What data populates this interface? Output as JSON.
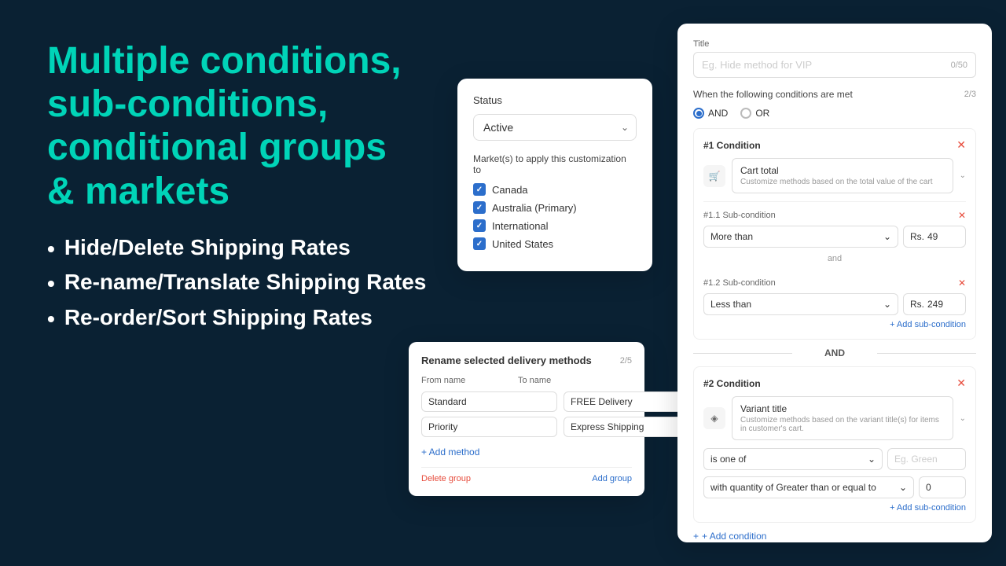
{
  "background": "#0a2133",
  "heading": {
    "line1": "Multiple conditions,",
    "line2": "sub-conditions,",
    "line3": "conditional groups",
    "line4": "& markets"
  },
  "bullets": [
    "Hide/Delete Shipping Rates",
    "Re-name/Translate Shipping Rates",
    "Re-order/Sort Shipping Rates"
  ],
  "status_card": {
    "title": "Status",
    "select_value": "Active",
    "markets_title": "Market(s) to apply this customization to",
    "markets": [
      {
        "label": "Canada",
        "checked": true
      },
      {
        "label": "Australia (Primary)",
        "checked": true
      },
      {
        "label": "International",
        "checked": true
      },
      {
        "label": "United States",
        "checked": true
      }
    ]
  },
  "rename_card": {
    "title": "Rename selected delivery methods",
    "count": "2/5",
    "col_from": "From name",
    "col_to": "To name",
    "rows": [
      {
        "from": "Standard",
        "to": "FREE Delivery"
      },
      {
        "from": "Priority",
        "to": "Express Shipping"
      }
    ],
    "add_label": "+ Add method",
    "footer_delete": "Delete group",
    "footer_add": "Add group"
  },
  "right_panel": {
    "title_label": "Title",
    "title_placeholder": "Eg. Hide method for VIP",
    "title_counter": "0/50",
    "conditions_label": "When the following conditions are met",
    "conditions_count": "2/3",
    "and_label": "AND",
    "or_label": "OR",
    "condition1": {
      "number": "#1 Condition",
      "type": "Cart total",
      "description": "Customize methods based on the total value of the cart",
      "subcondition1": {
        "number": "#1.1 Sub-condition",
        "operator": "More than",
        "prefix": "Rs.",
        "value": "49"
      },
      "and_text": "and",
      "subcondition2": {
        "number": "#1.2 Sub-condition",
        "operator": "Less than",
        "prefix": "Rs.",
        "value": "249"
      },
      "add_sub_label": "+ Add sub-condition"
    },
    "and_divider": "AND",
    "condition2": {
      "number": "#2 Condition",
      "type": "Variant title",
      "description": "Customize methods based on the variant title(s) for items in customer's cart.",
      "operator": "is one of",
      "value_placeholder": "Eg. Green",
      "quantity_label": "with quantity of Greater than or equal to",
      "quantity_value": "0",
      "add_sub_label": "+ Add sub-condition"
    },
    "add_condition_label": "+ Add condition"
  }
}
